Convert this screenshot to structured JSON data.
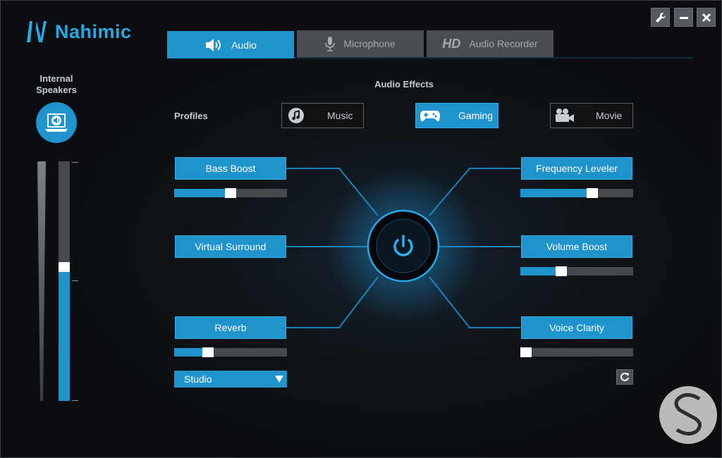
{
  "app": {
    "name": "Nahimic"
  },
  "window": {
    "settings_icon": "wrench-icon",
    "minimize_icon": "minimize-icon",
    "close_icon": "close-icon"
  },
  "tabs": [
    {
      "label": "Audio",
      "icon": "speaker-icon",
      "active": true
    },
    {
      "label": "Microphone",
      "icon": "microphone-icon",
      "active": false
    },
    {
      "prefix": "HD",
      "label": "Audio Recorder",
      "active": false
    }
  ],
  "device": {
    "label_line1": "Internal",
    "label_line2": "Speakers",
    "icon": "laptop-speaker-icon",
    "volume": 0.56
  },
  "section_title": "Audio Effects",
  "profiles": {
    "label": "Profiles",
    "items": [
      {
        "label": "Music",
        "icon": "music-note-icon",
        "active": false
      },
      {
        "label": "Gaming",
        "icon": "gamepad-icon",
        "active": true
      },
      {
        "label": "Movie",
        "icon": "movie-camera-icon",
        "active": false
      }
    ]
  },
  "effects": {
    "bass_boost": {
      "label": "Bass Boost",
      "level": 0.5
    },
    "virtual_surround": {
      "label": "Virtual Surround"
    },
    "reverb": {
      "label": "Reverb",
      "level": 0.28,
      "preset": "Studio"
    },
    "frequency_leveler": {
      "label": "Frequency Leveler",
      "level": 0.65
    },
    "volume_boost": {
      "label": "Volume Boost",
      "level": 0.35
    },
    "voice_clarity": {
      "label": "Voice Clarity",
      "level": 0.0
    }
  },
  "power": {
    "icon": "power-icon",
    "on": true
  },
  "colors": {
    "accent": "#1f93cc",
    "background": "#0d0f12",
    "tab_inactive": "#4a4d52"
  }
}
